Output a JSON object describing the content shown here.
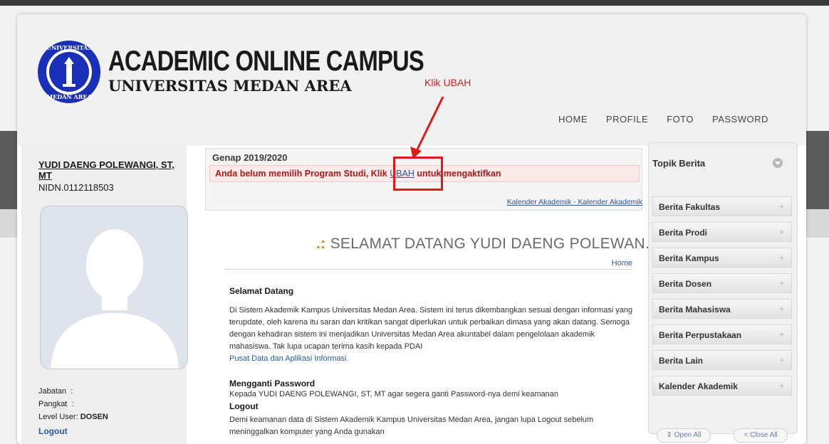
{
  "brand": {
    "title": "ACADEMIC ONLINE CAMPUS",
    "subtitle": "UNIVERSITAS MEDAN AREA",
    "seal_text": "UNIVERSITAS MEDAN AREA"
  },
  "annotation": {
    "label": "Klik UBAH"
  },
  "nav": {
    "items": [
      "HOME",
      "PROFILE",
      "FOTO",
      "PASSWORD"
    ]
  },
  "user": {
    "name": "YUDI DAENG POLEWANGI, ST, MT",
    "nidn": "NIDN.0112118503",
    "jabatan_label": "Jabatan",
    "pangkat_label": "Pangkat",
    "level_label": "Level User:",
    "level_value": "DOSEN",
    "logout": "Logout"
  },
  "notice": {
    "semester": "Genap 2019/2020",
    "alert_before": "Anda belum memilih Program Studi, Klik ",
    "alert_link": "UBAH",
    "alert_after": " untuk mengaktifkan",
    "kalender_link": "Kalender Akademik - Kalender Akademik"
  },
  "welcome": {
    "title": "SELAMAT DATANG YUDI DAENG POLEWAN...",
    "home_crumb": "Home"
  },
  "content": {
    "h1": "Selamat Datang",
    "p1": "Di Sistem Akademik Kampus Universitas Medan Area. Sistem ini terus dikembangkan sesuai dengan informasi yang terupdate, oleh karena itu saran dan kritikan sangat diperlukan untuk perbaikan dimasa yang akan datang. Semoga dengan kehadiran sistem ini menjadikan Universitas Medan Area akuntabel dalam pengelolaan akademik mahasiswa. Tak lupa ucapan terima kasih kepada PDAI",
    "p1_link": "Pusat Data dan Aplikasi Informasi.",
    "h2": "Mengganti Password",
    "p2": "Kepada YUDI DAENG POLEWANGI, ST, MT agar segera ganti Password-nya demi keamanan",
    "h3": "Logout",
    "p3": "Demi keamanan data di Sistem Akademik Kampus Universitas Medan Area, jangan lupa Logout sebelum meninggalkan komputer yang Anda gunakan"
  },
  "sidebar": {
    "title": "Topik Berita",
    "items": [
      "Berita Fakultas",
      "Berita Prodi",
      "Berita Kampus",
      "Berita Dosen",
      "Berita Mahasiswa",
      "Berita Perpustakaan",
      "Berita Lain",
      "Kalender Akademik"
    ],
    "open_all": "Open All",
    "close_all": "Close All"
  }
}
